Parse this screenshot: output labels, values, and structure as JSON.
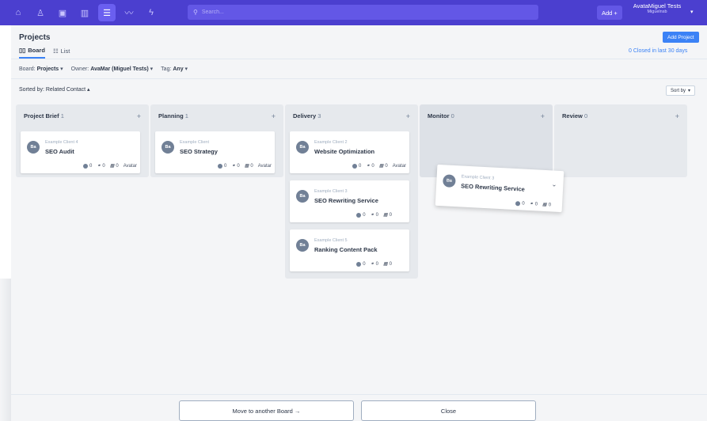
{
  "nav": {
    "icons": [
      "home-icon",
      "user-icon",
      "calendar-icon",
      "chart-icon",
      "board-icon",
      "trend-icon",
      "lightning-icon"
    ],
    "search_placeholder": "Search...",
    "add_label": "Add +",
    "user_name": "AvataMiguel Tests",
    "user_sub": "Miguelnsb",
    "accent": "#4b3fcf"
  },
  "page": {
    "title": "Projects",
    "add_project": "Add Project",
    "tabs": [
      {
        "label": "Board",
        "icon": "board-icon"
      },
      {
        "label": "List",
        "icon": "list-icon"
      }
    ],
    "closed_link": "0 Closed in last 30 days",
    "filters": {
      "board_label": "Board:",
      "board_value": "Projects",
      "owner_label": "Owner:",
      "owner_value": "AvaMar (Miguel Tests)",
      "tag_label": "Tag:",
      "tag_value": "Any"
    },
    "sorted_by": "Sorted by: Related Contact",
    "sort_by": "Sort by"
  },
  "columns": [
    {
      "title": "Project Brief",
      "count": "1"
    },
    {
      "title": "Planning",
      "count": "1"
    },
    {
      "title": "Delivery",
      "count": "3"
    },
    {
      "title": "Monitor",
      "count": "0"
    },
    {
      "title": "Review",
      "count": "0"
    }
  ],
  "cards": [
    {
      "client": "Example Client 4",
      "title": "SEO Audit",
      "initials": "Ba",
      "views": "0",
      "links": "0",
      "notes": "0",
      "assignee": "Avatar"
    },
    {
      "client": "Example Client",
      "title": "SEO Strategy",
      "initials": "Ba",
      "views": "0",
      "links": "0",
      "notes": "0",
      "assignee": "Avatar"
    },
    {
      "client": "Example Client 2",
      "title": "Website Optimization",
      "initials": "Ba",
      "views": "0",
      "links": "0",
      "notes": "0",
      "assignee": "Avatar"
    },
    {
      "client": "Example Client 3",
      "title": "SEO Rewriting Service",
      "initials": "Ba",
      "views": "0",
      "links": "0",
      "notes": "0"
    },
    {
      "client": "Example Client 5",
      "title": "Ranking Content Pack",
      "initials": "Ba",
      "views": "0",
      "links": "0",
      "notes": "0"
    }
  ],
  "drag_card": {
    "client": "Example Client 3",
    "title": "SEO Rewriting Service",
    "initials": "Ba",
    "views": "0",
    "links": "0",
    "notes": "0"
  },
  "footer": {
    "move_label": "Move to another Board →",
    "close_label": "Close"
  }
}
